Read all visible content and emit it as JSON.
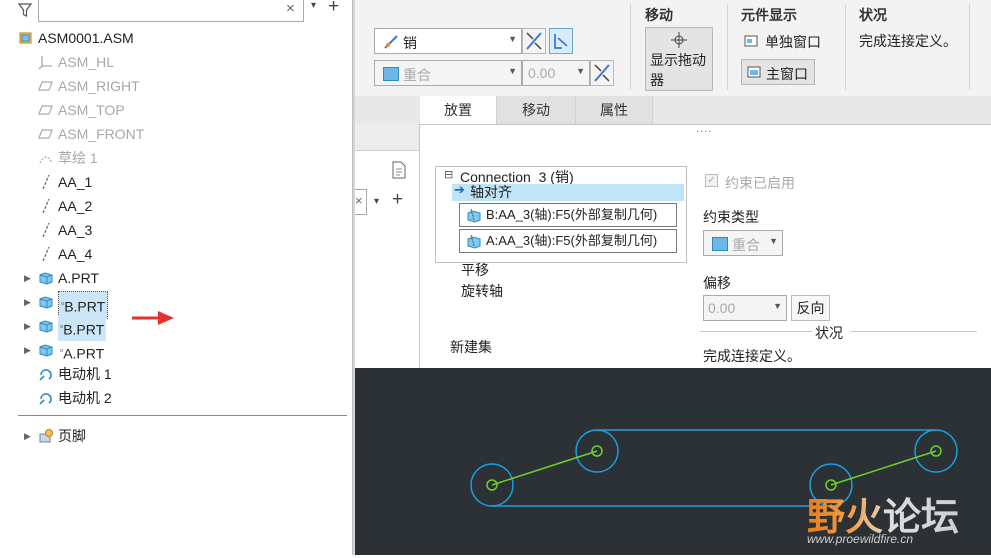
{
  "tree": {
    "filter": {
      "value": "",
      "clear_symbol": "×",
      "dropdown_symbol": "▾",
      "add_symbol": "+"
    },
    "items": [
      {
        "label": "ASM0001.ASM",
        "icon": "assembly-icon"
      },
      {
        "label": "ASM_HL",
        "icon": "csys-icon"
      },
      {
        "label": "ASM_RIGHT",
        "icon": "datum-plane-icon"
      },
      {
        "label": "ASM_TOP",
        "icon": "datum-plane-icon"
      },
      {
        "label": "ASM_FRONT",
        "icon": "datum-plane-icon"
      },
      {
        "label": "草绘 1",
        "icon": "sketch-icon"
      },
      {
        "label": "AA_1",
        "icon": "axis-icon"
      },
      {
        "label": "AA_2",
        "icon": "axis-icon"
      },
      {
        "label": "AA_3",
        "icon": "axis-icon"
      },
      {
        "label": "AA_4",
        "icon": "axis-icon"
      },
      {
        "label": "A.PRT",
        "icon": "part-icon"
      },
      {
        "label": "B.PRT",
        "icon": "part-icon",
        "flag": "▫"
      },
      {
        "label": "B.PRT",
        "icon": "part-icon",
        "flag": "▫"
      },
      {
        "label": "A.PRT",
        "icon": "part-icon",
        "flag": "▫"
      },
      {
        "label": "电动机 1",
        "icon": "motor-icon"
      },
      {
        "label": "电动机 2",
        "icon": "motor-icon"
      },
      {
        "label": "页脚",
        "icon": "footer-icon"
      }
    ]
  },
  "ribbon": {
    "connection_type": "销",
    "constraint_type": "重合",
    "offset_value": "0.00",
    "move_group": {
      "title": "移动",
      "button_line1": "显示拖动",
      "button_line2": "器"
    },
    "display_group": {
      "title": "元件显示",
      "separate_window": "单独窗口",
      "main_window": "主窗口"
    },
    "status_group": {
      "title": "状况",
      "text": "完成连接定义。"
    }
  },
  "tabs": [
    {
      "label": "放置",
      "active": true
    },
    {
      "label": "移动",
      "active": false
    },
    {
      "label": "属性",
      "active": false
    }
  ],
  "placement": {
    "connection_title": "Connection_3 (销)",
    "collapse_symbol": "⊟",
    "axis_align_label": "轴对齐",
    "references": [
      "B:AA_3(轴):F5(外部复制几何)",
      "A:AA_3(轴):F5(外部复制几何)"
    ],
    "translation_label": "平移",
    "rotation_axis_label": "旋转轴",
    "new_set_label": "新建集",
    "constraint_enabled_label": "约束已启用",
    "constraint_type_label": "约束类型",
    "constraint_type_value": "重合",
    "offset_label": "偏移",
    "offset_value": "0.00",
    "reverse_button": "反向",
    "status_heading": "状况",
    "status_text": "完成连接定义。",
    "dots": "....",
    "mid_close_symbol": "×",
    "mid_dropdown_symbol": "▾",
    "mid_add_symbol": "+"
  },
  "watermark": {
    "title": "野火论坛",
    "url": "www.proewildfire.cn"
  },
  "colors": {
    "canvas_bg": "#2b3134",
    "geometry_blue": "#1aa0e0",
    "geometry_green": "#6ed12d",
    "selection": "#cde6f7",
    "arrow_red": "#e5322d",
    "watermark_orange": "#e67d1c"
  }
}
